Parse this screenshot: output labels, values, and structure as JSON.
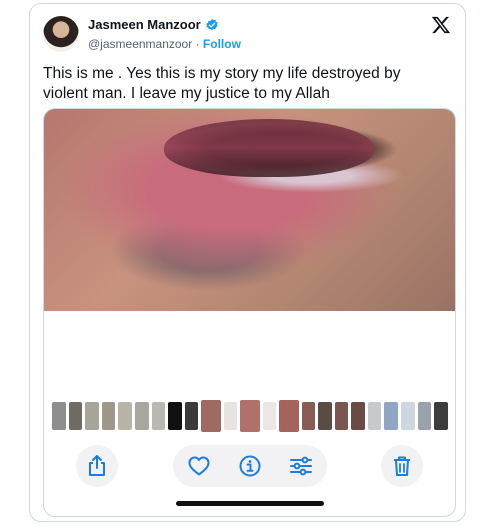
{
  "author": {
    "name": "Jasmeen Manzoor",
    "handle": "@jasmeenmanzoor",
    "separator": "·",
    "follow_label": "Follow"
  },
  "platform_icon": "x-logo-icon",
  "tweet": {
    "text": "This is me . Yes this is my story my life destroyed by violent man. I leave my justice to my Allah"
  },
  "media": {
    "thumbnail_count": 26,
    "toolbar_icons": [
      "share-icon",
      "heart-icon",
      "info-icon",
      "adjust-icon",
      "trash-icon"
    ]
  },
  "colors": {
    "accent": "#1d9bf0",
    "action_icon": "#1a7ee0",
    "text": "#0f1419",
    "secondary_text": "#536471"
  }
}
